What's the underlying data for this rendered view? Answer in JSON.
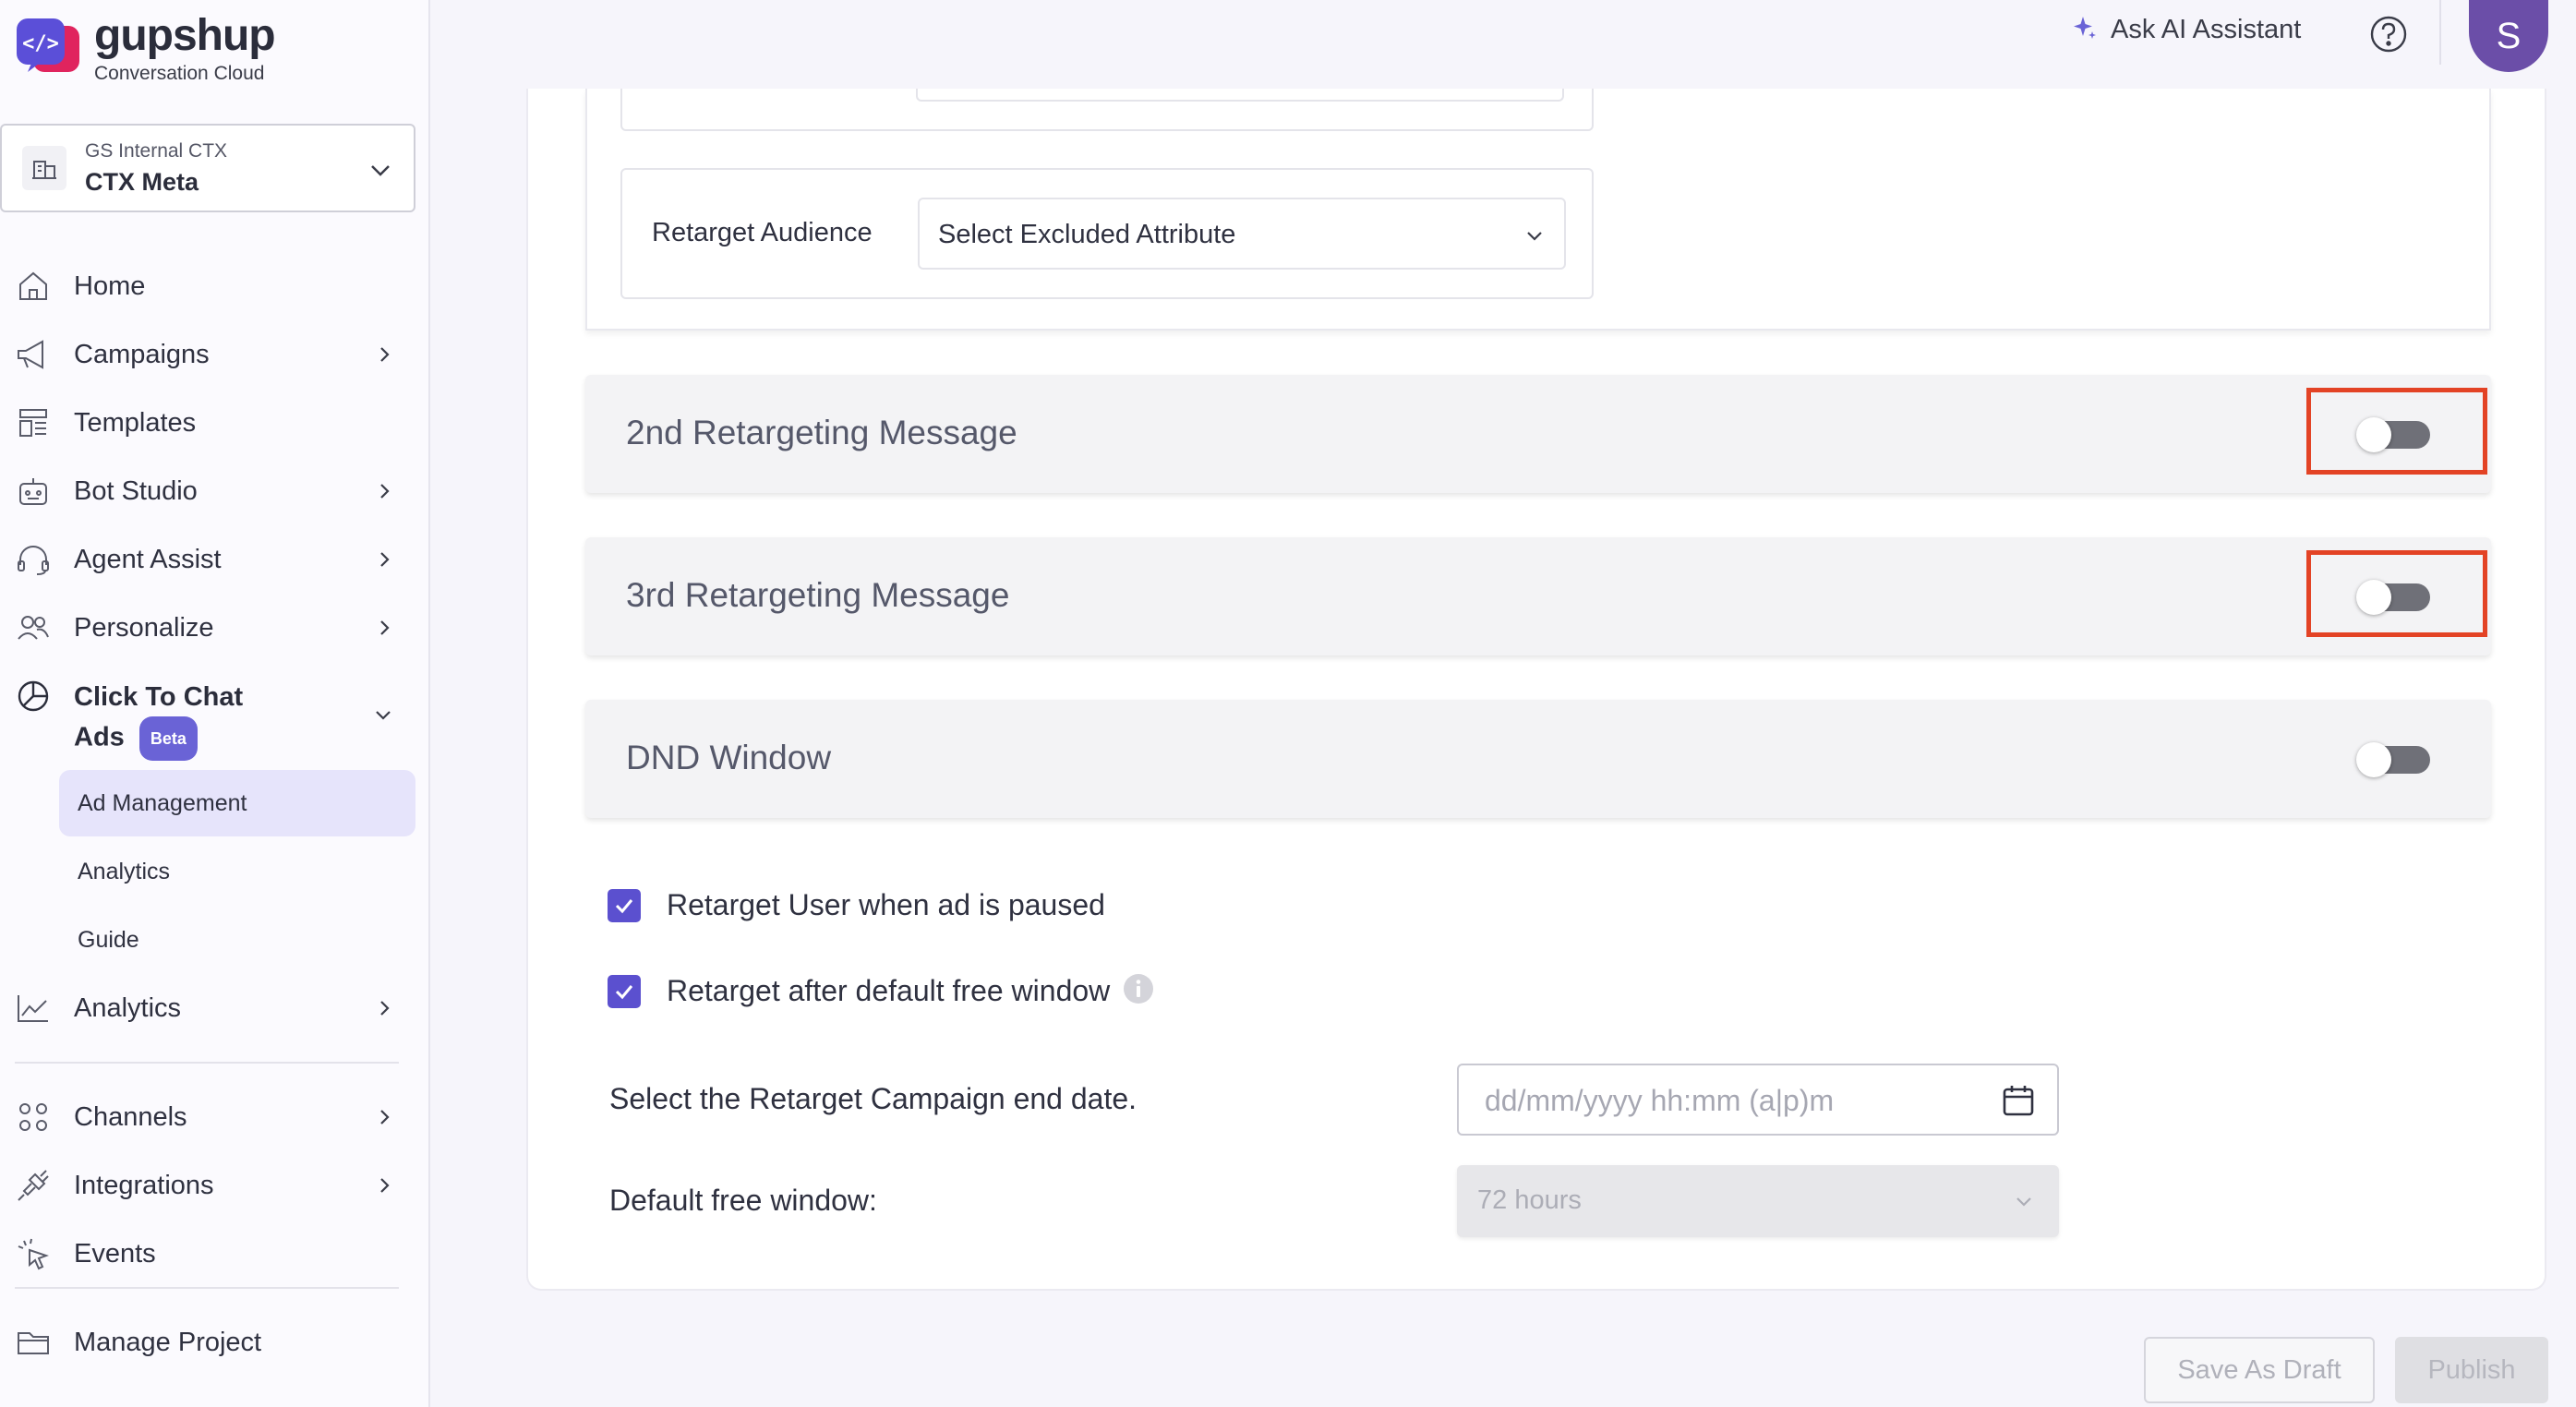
{
  "brand": {
    "title": "gupshup",
    "subtitle": "Conversation Cloud"
  },
  "project": {
    "org": "GS Internal CTX",
    "name": "CTX Meta"
  },
  "sidebar": {
    "items": [
      {
        "label": "Home"
      },
      {
        "label": "Campaigns"
      },
      {
        "label": "Templates"
      },
      {
        "label": "Bot Studio"
      },
      {
        "label": "Agent Assist"
      },
      {
        "label": "Personalize"
      },
      {
        "label": "Click To Chat",
        "label2": "Ads",
        "badge": "Beta"
      },
      {
        "label": "Analytics"
      },
      {
        "label": "Channels"
      },
      {
        "label": "Integrations"
      },
      {
        "label": "Events"
      },
      {
        "label": "Manage Project"
      }
    ],
    "sub_items": [
      {
        "label": "Ad Management",
        "active": true
      },
      {
        "label": "Analytics"
      },
      {
        "label": "Guide"
      }
    ]
  },
  "topbar": {
    "ask_ai": "Ask AI Assistant",
    "avatar_initial": "S"
  },
  "retarget": {
    "audience_label": "Retarget Audience",
    "attribute_placeholder": "Select Excluded Attribute"
  },
  "sections": [
    {
      "title": "2nd Retargeting Message",
      "enabled": false,
      "highlighted": true
    },
    {
      "title": "3rd Retargeting Message",
      "enabled": false,
      "highlighted": true
    },
    {
      "title": "DND Window",
      "enabled": false,
      "highlighted": false
    }
  ],
  "options": {
    "paused_label": "Retarget User when ad is paused",
    "paused_checked": true,
    "free_window_label": "Retarget after default free window",
    "free_window_checked": true
  },
  "form": {
    "end_date_label": "Select the Retarget Campaign end date.",
    "end_date_placeholder": "dd/mm/yyyy hh:mm (a|p)m",
    "free_window_label": "Default free window:",
    "free_window_value": "72 hours"
  },
  "actions": {
    "save_draft": "Save As Draft",
    "publish": "Publish"
  },
  "colors": {
    "accent": "#5b50cf",
    "highlight": "#e34325",
    "avatar": "#6b4ea8"
  }
}
